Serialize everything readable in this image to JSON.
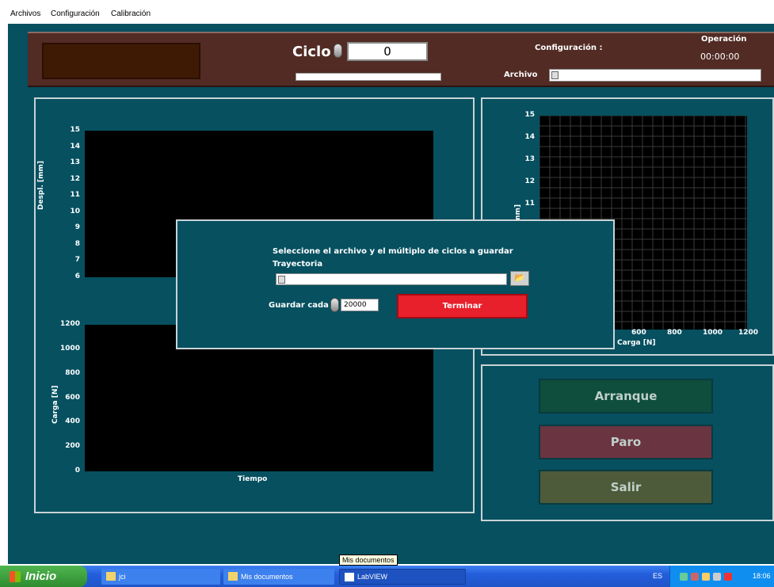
{
  "menu": {
    "items": [
      "Archivos",
      "Configuración",
      "Calibración"
    ]
  },
  "header": {
    "ciclo_label": "Ciclo",
    "ciclo_value": "0",
    "configuracion_label": "Configuración :",
    "operacion_label": "Operación",
    "operacion_time": "00:00:00",
    "archivo_label": "Archivo",
    "archivo_value": ""
  },
  "chart_data": [
    {
      "type": "line",
      "name": "desplazamiento",
      "ylabel": "Despl. [mm]",
      "xlabel": "",
      "ylim": [
        6,
        15
      ],
      "yticks": [
        "15",
        "14",
        "13",
        "12",
        "11",
        "10",
        "9",
        "8",
        "7",
        "6"
      ],
      "series": []
    },
    {
      "type": "line",
      "name": "carga",
      "ylabel": "Carga [N]",
      "xlabel": "Tiempo",
      "ylim": [
        0,
        1200
      ],
      "yticks": [
        "1200",
        "1000",
        "800",
        "600",
        "400",
        "200",
        "0"
      ],
      "series": []
    },
    {
      "type": "scatter",
      "name": "despl-vs-carga",
      "ylabel": "[mm]",
      "xlabel": "Carga [N]",
      "ylim": [
        10,
        15
      ],
      "xlim": [
        0,
        1200
      ],
      "yticks": [
        "15",
        "14",
        "13",
        "12",
        "11"
      ],
      "xticks": [
        "600",
        "800",
        "1000",
        "1200"
      ],
      "grid": true,
      "series": []
    }
  ],
  "controls": {
    "arranque": "Arranque",
    "paro": "Paro",
    "salir": "Salir"
  },
  "dialog": {
    "title": "Seleccione el archivo y el múltiplo de ciclos a guardar",
    "trayectoria_label": "Trayectoria",
    "trayectoria_value": "",
    "guardar_label": "Guardar cada",
    "guardar_value": "20000",
    "terminar_label": "Terminar"
  },
  "tooltip": "Mis documentos",
  "taskbar": {
    "start_label": "Inicio",
    "tasks": [
      "jci",
      "Mis documentos",
      "LabVIEW"
    ],
    "language": "ES",
    "clock": "18:06"
  },
  "colors": {
    "background": "#065060",
    "header": "#512b24",
    "arranque": "#0f4d3c",
    "paro": "#6b3441",
    "salir": "#4d5b3a",
    "terminar": "#e8202b"
  }
}
